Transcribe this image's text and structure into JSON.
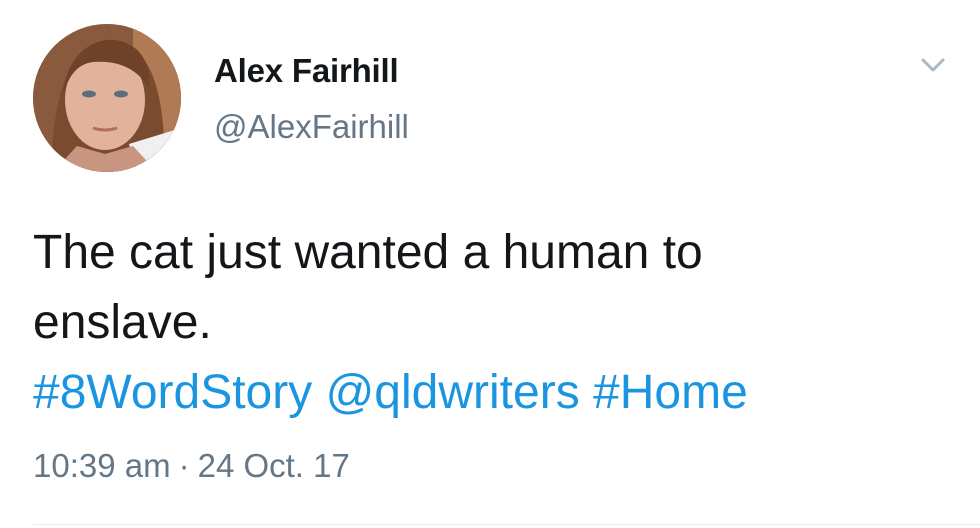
{
  "user": {
    "display_name": "Alex Fairhill",
    "handle": "@AlexFairhill"
  },
  "tweet": {
    "text_line1": "The cat just wanted a human to",
    "text_line2": "enslave.",
    "tags": [
      "#8WordStory",
      "@qldwriters",
      "#Home"
    ]
  },
  "meta": {
    "time": "10:39 am",
    "separator": "·",
    "date": "24 Oct. 17"
  },
  "icons": {
    "menu": "chevron-down-icon"
  },
  "colors": {
    "text": "#14171a",
    "secondary": "#657786",
    "link": "#1b95e0"
  }
}
